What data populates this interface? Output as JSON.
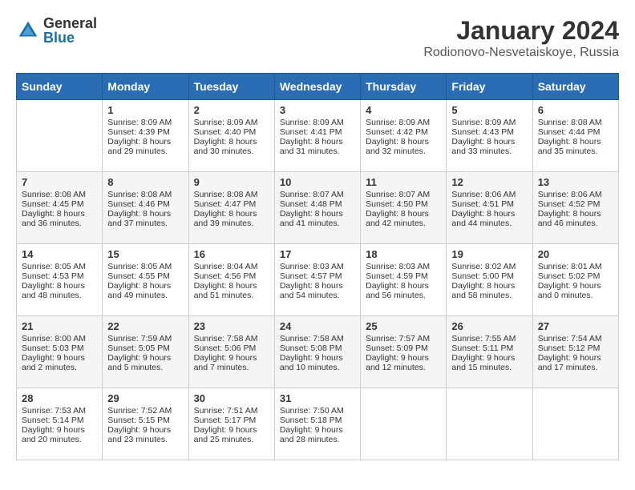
{
  "logo": {
    "general": "General",
    "blue": "Blue"
  },
  "title": "January 2024",
  "subtitle": "Rodionovo-Nesvetaiskoye, Russia",
  "days_of_week": [
    "Sunday",
    "Monday",
    "Tuesday",
    "Wednesday",
    "Thursday",
    "Friday",
    "Saturday"
  ],
  "weeks": [
    [
      {
        "num": "",
        "sunrise": "",
        "sunset": "",
        "daylight": "",
        "empty": true
      },
      {
        "num": "1",
        "sunrise": "Sunrise: 8:09 AM",
        "sunset": "Sunset: 4:39 PM",
        "daylight": "Daylight: 8 hours and 29 minutes."
      },
      {
        "num": "2",
        "sunrise": "Sunrise: 8:09 AM",
        "sunset": "Sunset: 4:40 PM",
        "daylight": "Daylight: 8 hours and 30 minutes."
      },
      {
        "num": "3",
        "sunrise": "Sunrise: 8:09 AM",
        "sunset": "Sunset: 4:41 PM",
        "daylight": "Daylight: 8 hours and 31 minutes."
      },
      {
        "num": "4",
        "sunrise": "Sunrise: 8:09 AM",
        "sunset": "Sunset: 4:42 PM",
        "daylight": "Daylight: 8 hours and 32 minutes."
      },
      {
        "num": "5",
        "sunrise": "Sunrise: 8:09 AM",
        "sunset": "Sunset: 4:43 PM",
        "daylight": "Daylight: 8 hours and 33 minutes."
      },
      {
        "num": "6",
        "sunrise": "Sunrise: 8:08 AM",
        "sunset": "Sunset: 4:44 PM",
        "daylight": "Daylight: 8 hours and 35 minutes."
      }
    ],
    [
      {
        "num": "7",
        "sunrise": "Sunrise: 8:08 AM",
        "sunset": "Sunset: 4:45 PM",
        "daylight": "Daylight: 8 hours and 36 minutes."
      },
      {
        "num": "8",
        "sunrise": "Sunrise: 8:08 AM",
        "sunset": "Sunset: 4:46 PM",
        "daylight": "Daylight: 8 hours and 37 minutes."
      },
      {
        "num": "9",
        "sunrise": "Sunrise: 8:08 AM",
        "sunset": "Sunset: 4:47 PM",
        "daylight": "Daylight: 8 hours and 39 minutes."
      },
      {
        "num": "10",
        "sunrise": "Sunrise: 8:07 AM",
        "sunset": "Sunset: 4:48 PM",
        "daylight": "Daylight: 8 hours and 41 minutes."
      },
      {
        "num": "11",
        "sunrise": "Sunrise: 8:07 AM",
        "sunset": "Sunset: 4:50 PM",
        "daylight": "Daylight: 8 hours and 42 minutes."
      },
      {
        "num": "12",
        "sunrise": "Sunrise: 8:06 AM",
        "sunset": "Sunset: 4:51 PM",
        "daylight": "Daylight: 8 hours and 44 minutes."
      },
      {
        "num": "13",
        "sunrise": "Sunrise: 8:06 AM",
        "sunset": "Sunset: 4:52 PM",
        "daylight": "Daylight: 8 hours and 46 minutes."
      }
    ],
    [
      {
        "num": "14",
        "sunrise": "Sunrise: 8:05 AM",
        "sunset": "Sunset: 4:53 PM",
        "daylight": "Daylight: 8 hours and 48 minutes."
      },
      {
        "num": "15",
        "sunrise": "Sunrise: 8:05 AM",
        "sunset": "Sunset: 4:55 PM",
        "daylight": "Daylight: 8 hours and 49 minutes."
      },
      {
        "num": "16",
        "sunrise": "Sunrise: 8:04 AM",
        "sunset": "Sunset: 4:56 PM",
        "daylight": "Daylight: 8 hours and 51 minutes."
      },
      {
        "num": "17",
        "sunrise": "Sunrise: 8:03 AM",
        "sunset": "Sunset: 4:57 PM",
        "daylight": "Daylight: 8 hours and 54 minutes."
      },
      {
        "num": "18",
        "sunrise": "Sunrise: 8:03 AM",
        "sunset": "Sunset: 4:59 PM",
        "daylight": "Daylight: 8 hours and 56 minutes."
      },
      {
        "num": "19",
        "sunrise": "Sunrise: 8:02 AM",
        "sunset": "Sunset: 5:00 PM",
        "daylight": "Daylight: 8 hours and 58 minutes."
      },
      {
        "num": "20",
        "sunrise": "Sunrise: 8:01 AM",
        "sunset": "Sunset: 5:02 PM",
        "daylight": "Daylight: 9 hours and 0 minutes."
      }
    ],
    [
      {
        "num": "21",
        "sunrise": "Sunrise: 8:00 AM",
        "sunset": "Sunset: 5:03 PM",
        "daylight": "Daylight: 9 hours and 2 minutes."
      },
      {
        "num": "22",
        "sunrise": "Sunrise: 7:59 AM",
        "sunset": "Sunset: 5:05 PM",
        "daylight": "Daylight: 9 hours and 5 minutes."
      },
      {
        "num": "23",
        "sunrise": "Sunrise: 7:58 AM",
        "sunset": "Sunset: 5:06 PM",
        "daylight": "Daylight: 9 hours and 7 minutes."
      },
      {
        "num": "24",
        "sunrise": "Sunrise: 7:58 AM",
        "sunset": "Sunset: 5:08 PM",
        "daylight": "Daylight: 9 hours and 10 minutes."
      },
      {
        "num": "25",
        "sunrise": "Sunrise: 7:57 AM",
        "sunset": "Sunset: 5:09 PM",
        "daylight": "Daylight: 9 hours and 12 minutes."
      },
      {
        "num": "26",
        "sunrise": "Sunrise: 7:55 AM",
        "sunset": "Sunset: 5:11 PM",
        "daylight": "Daylight: 9 hours and 15 minutes."
      },
      {
        "num": "27",
        "sunrise": "Sunrise: 7:54 AM",
        "sunset": "Sunset: 5:12 PM",
        "daylight": "Daylight: 9 hours and 17 minutes."
      }
    ],
    [
      {
        "num": "28",
        "sunrise": "Sunrise: 7:53 AM",
        "sunset": "Sunset: 5:14 PM",
        "daylight": "Daylight: 9 hours and 20 minutes."
      },
      {
        "num": "29",
        "sunrise": "Sunrise: 7:52 AM",
        "sunset": "Sunset: 5:15 PM",
        "daylight": "Daylight: 9 hours and 23 minutes."
      },
      {
        "num": "30",
        "sunrise": "Sunrise: 7:51 AM",
        "sunset": "Sunset: 5:17 PM",
        "daylight": "Daylight: 9 hours and 25 minutes."
      },
      {
        "num": "31",
        "sunrise": "Sunrise: 7:50 AM",
        "sunset": "Sunset: 5:18 PM",
        "daylight": "Daylight: 9 hours and 28 minutes."
      },
      {
        "num": "",
        "sunrise": "",
        "sunset": "",
        "daylight": "",
        "empty": true
      },
      {
        "num": "",
        "sunrise": "",
        "sunset": "",
        "daylight": "",
        "empty": true
      },
      {
        "num": "",
        "sunrise": "",
        "sunset": "",
        "daylight": "",
        "empty": true
      }
    ]
  ]
}
